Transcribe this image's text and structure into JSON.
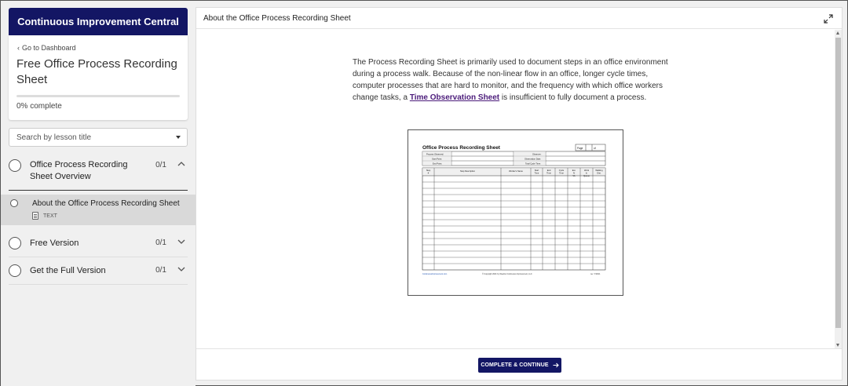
{
  "sidebar": {
    "school_name": "Continuous Improvement Central",
    "back_link": "Go to Dashboard",
    "course_title": "Free Office Process Recording Sheet",
    "progress_percent": 0,
    "progress_text_number": "0%",
    "progress_text_label": "complete",
    "search_placeholder": "Search by lesson title",
    "sections": [
      {
        "title": "Office Process Recording Sheet Overview",
        "count": "0/1",
        "expanded": true
      },
      {
        "title": "Free Version",
        "count": "0/1",
        "expanded": false
      },
      {
        "title": "Get the Full Version",
        "count": "0/1",
        "expanded": false
      }
    ],
    "active_lesson": {
      "title": "About the Office Process Recording Sheet",
      "type": "TEXT"
    }
  },
  "main": {
    "title": "About the Office Process Recording Sheet",
    "body_before_link": "The Process Recording Sheet is primarily used to document steps in an office environment during a process walk. Because of the non-linear flow in an office, longer cycle times, computer processes that are hard to monitor, and the frequency with which office workers change tasks, a ",
    "link_text": "Time Observation Sheet",
    "body_after_link": " is insufficient to fully document a process.",
    "complete_button": "COMPLETE & CONTINUE",
    "sheet": {
      "title": "Office Process Recording Sheet",
      "page_label": "Page",
      "of_label": "of",
      "left_fields": [
        "Process Observed:",
        "Start Point:",
        "End Point:"
      ],
      "right_fields": [
        "Observer:",
        "Observation Date:",
        "Total Cycle Time:"
      ],
      "columns": [
        "Step #",
        "Step Description",
        "Worker's Name",
        "Start Time",
        "End Time",
        "Cycle Time",
        "Est. % VA",
        "Work In Queue",
        "Walking Dist."
      ],
      "footer_left": "ContinuousImprovement.com",
      "footer_center": "© Copyright 2021 by Weeble Continuous Improvement, LLC",
      "footer_right": "rev. 7/16/21"
    }
  }
}
